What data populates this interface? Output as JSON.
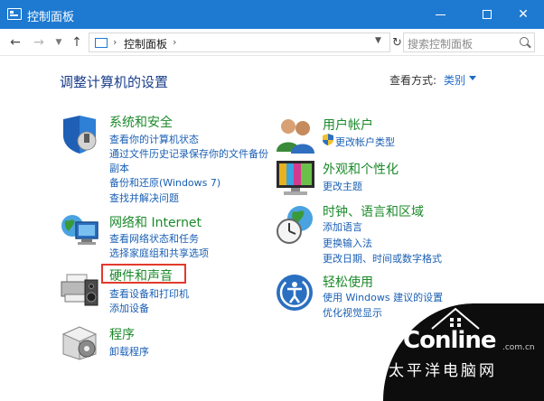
{
  "window": {
    "title": "控制面板"
  },
  "addressbar": {
    "path": "控制面板",
    "search_placeholder": "搜索控制面板"
  },
  "header": {
    "title": "调整计算机的设置",
    "view_label": "查看方式:",
    "view_value": "类别"
  },
  "categories": {
    "system": {
      "title": "系统和安全",
      "links": [
        "查看你的计算机状态",
        "通过文件历史记录保存你的文件备份",
        "副本",
        "备份和还原(Windows 7)",
        "查找并解决问题"
      ]
    },
    "network": {
      "title": "网络和 Internet",
      "links": [
        "查看网络状态和任务",
        "选择家庭组和共享选项"
      ]
    },
    "hardware": {
      "title": "硬件和声音",
      "links": [
        "查看设备和打印机",
        "添加设备"
      ]
    },
    "programs": {
      "title": "程序",
      "links": [
        "卸载程序"
      ]
    },
    "users": {
      "title": "用户帐户",
      "links": [
        "更改帐户类型"
      ]
    },
    "appearance": {
      "title": "外观和个性化",
      "links": [
        "更改主题"
      ]
    },
    "clock": {
      "title": "时钟、语言和区域",
      "links": [
        "添加语言",
        "更换输入法",
        "更改日期、时间或数字格式"
      ]
    },
    "ease": {
      "title": "轻松使用",
      "links": [
        "使用 Windows 建议的设置",
        "优化视觉显示"
      ]
    }
  },
  "watermark": {
    "brand": "PConline",
    "domain": ".com.cn",
    "chinese": "太平洋电脑网"
  },
  "colors": {
    "titlebar": "#1e7ad1",
    "category_title": "#1b8a2a",
    "link": "#1a5fb4",
    "highlight": "#e23a2b"
  }
}
